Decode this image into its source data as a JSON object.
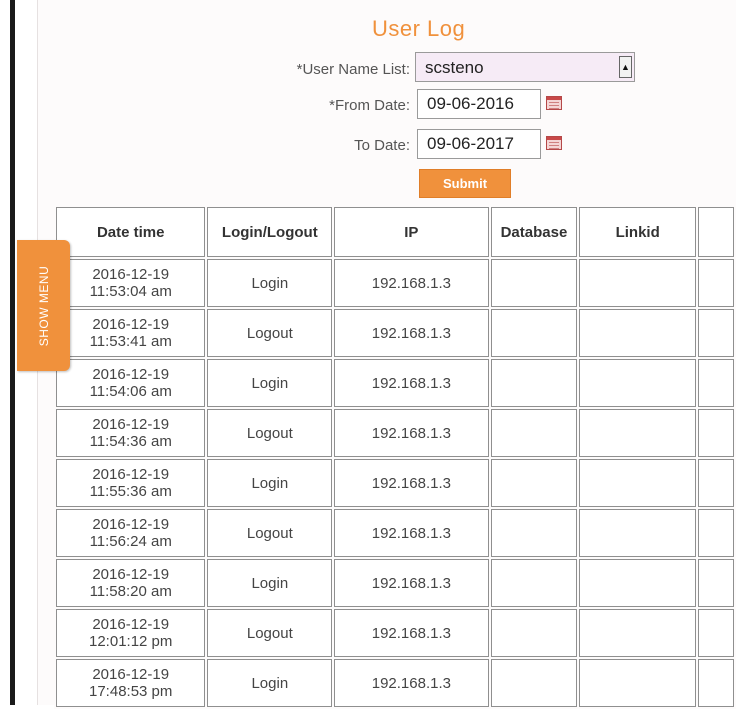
{
  "page": {
    "title": "User Log"
  },
  "form": {
    "user_label": "*User Name List:",
    "user_value": "scsteno",
    "from_label": "*From Date:",
    "from_value": "09-06-2016",
    "to_label": "To Date:",
    "to_value": "09-06-2017",
    "submit_label": "Submit"
  },
  "side_tab": {
    "label": "SHOW MENU"
  },
  "table": {
    "headers": [
      "Date time",
      "Login/Logout",
      "IP",
      "Database",
      "Linkid",
      ""
    ],
    "rows": [
      {
        "date": "2016-12-19",
        "time": "11:53:04 am",
        "action": "Login",
        "ip": "192.168.1.3",
        "database": "",
        "linkid": ""
      },
      {
        "date": "2016-12-19",
        "time": "11:53:41 am",
        "action": "Logout",
        "ip": "192.168.1.3",
        "database": "",
        "linkid": ""
      },
      {
        "date": "2016-12-19",
        "time": "11:54:06 am",
        "action": "Login",
        "ip": "192.168.1.3",
        "database": "",
        "linkid": ""
      },
      {
        "date": "2016-12-19",
        "time": "11:54:36 am",
        "action": "Logout",
        "ip": "192.168.1.3",
        "database": "",
        "linkid": ""
      },
      {
        "date": "2016-12-19",
        "time": "11:55:36 am",
        "action": "Login",
        "ip": "192.168.1.3",
        "database": "",
        "linkid": ""
      },
      {
        "date": "2016-12-19",
        "time": "11:56:24 am",
        "action": "Logout",
        "ip": "192.168.1.3",
        "database": "",
        "linkid": ""
      },
      {
        "date": "2016-12-19",
        "time": "11:58:20 am",
        "action": "Login",
        "ip": "192.168.1.3",
        "database": "",
        "linkid": ""
      },
      {
        "date": "2016-12-19",
        "time": "12:01:12 pm",
        "action": "Logout",
        "ip": "192.168.1.3",
        "database": "",
        "linkid": ""
      },
      {
        "date": "2016-12-19",
        "time": "17:48:53 pm",
        "action": "Login",
        "ip": "192.168.1.3",
        "database": "",
        "linkid": ""
      }
    ]
  },
  "colors": {
    "accent": "#f0913c",
    "select_bg": "#f6ebf6",
    "calendar": "#c94848"
  },
  "icons": {
    "calendar": "calendar-icon",
    "dropdown": "dropdown-arrow-icon"
  }
}
